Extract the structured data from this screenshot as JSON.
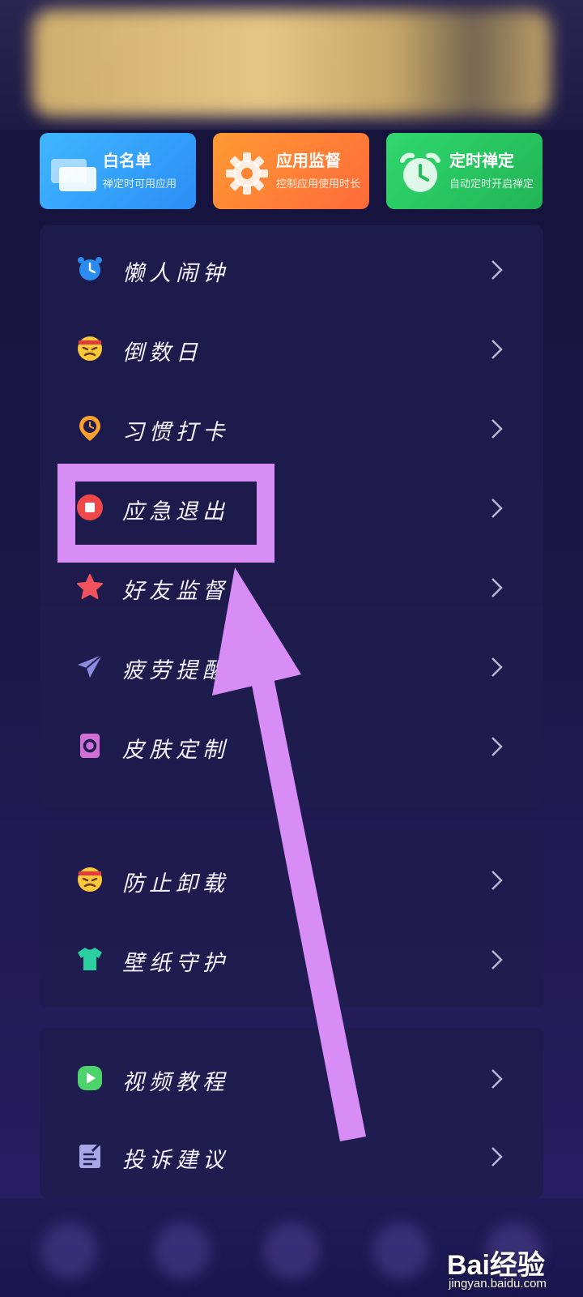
{
  "quick_actions": [
    {
      "title": "白名单",
      "subtitle": "禅定时可用应用",
      "icon": "cards-icon",
      "color": "#2b8ef5"
    },
    {
      "title": "应用监督",
      "subtitle": "控制应用使用时长",
      "icon": "gear-icon",
      "color": "#ff6a3a"
    },
    {
      "title": "定时禅定",
      "subtitle": "自动定时开启禅定",
      "icon": "alarm-clock-icon",
      "color": "#22b455"
    }
  ],
  "menu_group_1": [
    {
      "label": "懒人闹钟",
      "icon": "alarm-clock-icon"
    },
    {
      "label": "倒数日",
      "icon": "angry-face-icon"
    },
    {
      "label": "习惯打卡",
      "icon": "location-clock-icon"
    },
    {
      "label": "应急退出",
      "icon": "stop-icon"
    },
    {
      "label": "好友监督",
      "icon": "star-icon"
    },
    {
      "label": "疲劳提醒",
      "icon": "paper-plane-icon"
    },
    {
      "label": "皮肤定制",
      "icon": "skin-icon"
    }
  ],
  "menu_group_2": [
    {
      "label": "防止卸载",
      "icon": "angry-face-icon"
    },
    {
      "label": "壁纸守护",
      "icon": "tshirt-icon"
    }
  ],
  "menu_group_3": [
    {
      "label": "视频教程",
      "icon": "play-icon"
    },
    {
      "label": "投诉建议",
      "icon": "note-edit-icon"
    }
  ],
  "annotation": {
    "highlight_color": "#d88cf5"
  },
  "watermark": {
    "brand": "Bai经验",
    "url": "jingyan.baidu.com"
  }
}
